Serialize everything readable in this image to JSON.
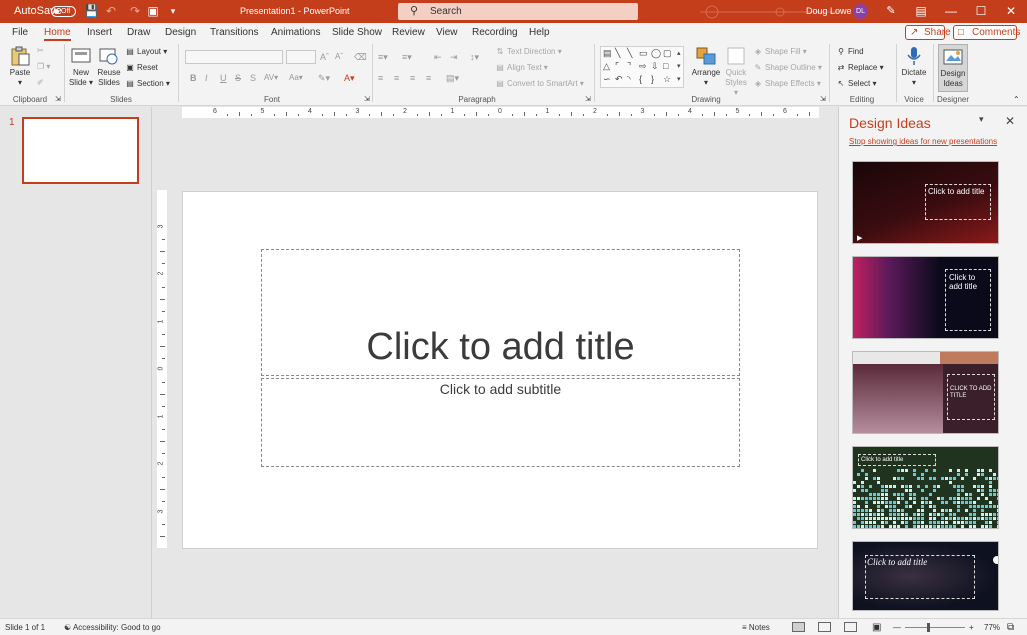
{
  "titlebar": {
    "autosave_label": "AutoSave",
    "autosave_state": "Off",
    "doc_title": "Presentation1 - PowerPoint",
    "search_placeholder": "Search",
    "user_name": "Doug Lowe",
    "user_initials": "DL"
  },
  "tabs": [
    "File",
    "Home",
    "Insert",
    "Draw",
    "Design",
    "Transitions",
    "Animations",
    "Slide Show",
    "Review",
    "View",
    "Recording",
    "Help"
  ],
  "active_tab": "Home",
  "share_label": "Share",
  "comments_label": "Comments",
  "ribbon": {
    "clipboard": {
      "paste": "Paste",
      "label": "Clipboard"
    },
    "slides": {
      "new_slide_1": "New",
      "new_slide_2": "Slide",
      "reuse_1": "Reuse",
      "reuse_2": "Slides",
      "layout": "Layout",
      "reset": "Reset",
      "section": "Section",
      "label": "Slides"
    },
    "font": {
      "label": "Font",
      "bold": "B",
      "italic": "I",
      "underline": "U",
      "strike": "S",
      "spacing": "AV",
      "case": "Aa",
      "grow": "A",
      "shrink": "A"
    },
    "paragraph": {
      "label": "Paragraph",
      "text_direction": "Text Direction",
      "align_text": "Align Text",
      "convert_smartart": "Convert to SmartArt"
    },
    "drawing": {
      "label": "Drawing",
      "arrange": "Arrange",
      "quick_styles_1": "Quick",
      "quick_styles_2": "Styles",
      "shape_fill": "Shape Fill",
      "shape_outline": "Shape Outline",
      "shape_effects": "Shape Effects"
    },
    "editing": {
      "label": "Editing",
      "find": "Find",
      "replace": "Replace",
      "select": "Select"
    },
    "voice": {
      "label": "Voice",
      "dictate": "Dictate"
    },
    "designer": {
      "label": "Designer",
      "design_ideas_1": "Design",
      "design_ideas_2": "Ideas"
    }
  },
  "thumbnails": {
    "slide_number": "1"
  },
  "slide": {
    "title_placeholder": "Click to add title",
    "subtitle_placeholder": "Click to add subtitle"
  },
  "hruler_labels": [
    "6",
    "5",
    "4",
    "3",
    "2",
    "1",
    "0",
    "1",
    "2",
    "3",
    "4",
    "5",
    "6"
  ],
  "vruler_labels": [
    "3",
    "2",
    "1",
    "0",
    "1",
    "2",
    "3"
  ],
  "design_pane": {
    "title": "Design Ideas",
    "stop_link": "Stop showing ideas for new presentations",
    "ideas": [
      {
        "title": "Click to add title",
        "colors": [
          "#1a0608",
          "#8a1a1a"
        ]
      },
      {
        "title": "Click to add title",
        "colors": [
          "#0a0a1a",
          "#b0306a"
        ]
      },
      {
        "title": "CLICK TO ADD TITLE",
        "colors": [
          "#3b1f2a",
          "#c07a5e"
        ]
      },
      {
        "title": "Click to add title",
        "colors": [
          "#20331f",
          "#63c9db"
        ]
      },
      {
        "title": "Click to add title",
        "colors": [
          "#0e1120",
          "#5a4a3a"
        ]
      }
    ]
  },
  "statusbar": {
    "slide_info": "Slide 1 of 1",
    "accessibility": "Accessibility: Good to go",
    "notes": "Notes",
    "zoom": "77%"
  }
}
